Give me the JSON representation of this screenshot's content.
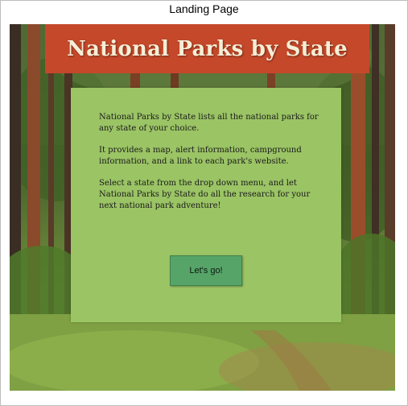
{
  "caption": "Landing Page",
  "header": {
    "title": "National Parks by State"
  },
  "intro": {
    "paragraph_1": "National Parks by State lists all the national parks for any state of your choice.",
    "paragraph_2": "It provides a map, alert information, campground information, and a link to each park's website.",
    "paragraph_3": "Select a state from the drop down menu, and let National Parks by State do all the research for your next national park adventure!"
  },
  "cta": {
    "label": "Let's go!"
  },
  "colors": {
    "header_bg": "#c5482a",
    "header_text": "#f6eed6",
    "panel_bg": "#9bc465",
    "button_bg": "#56a468"
  }
}
